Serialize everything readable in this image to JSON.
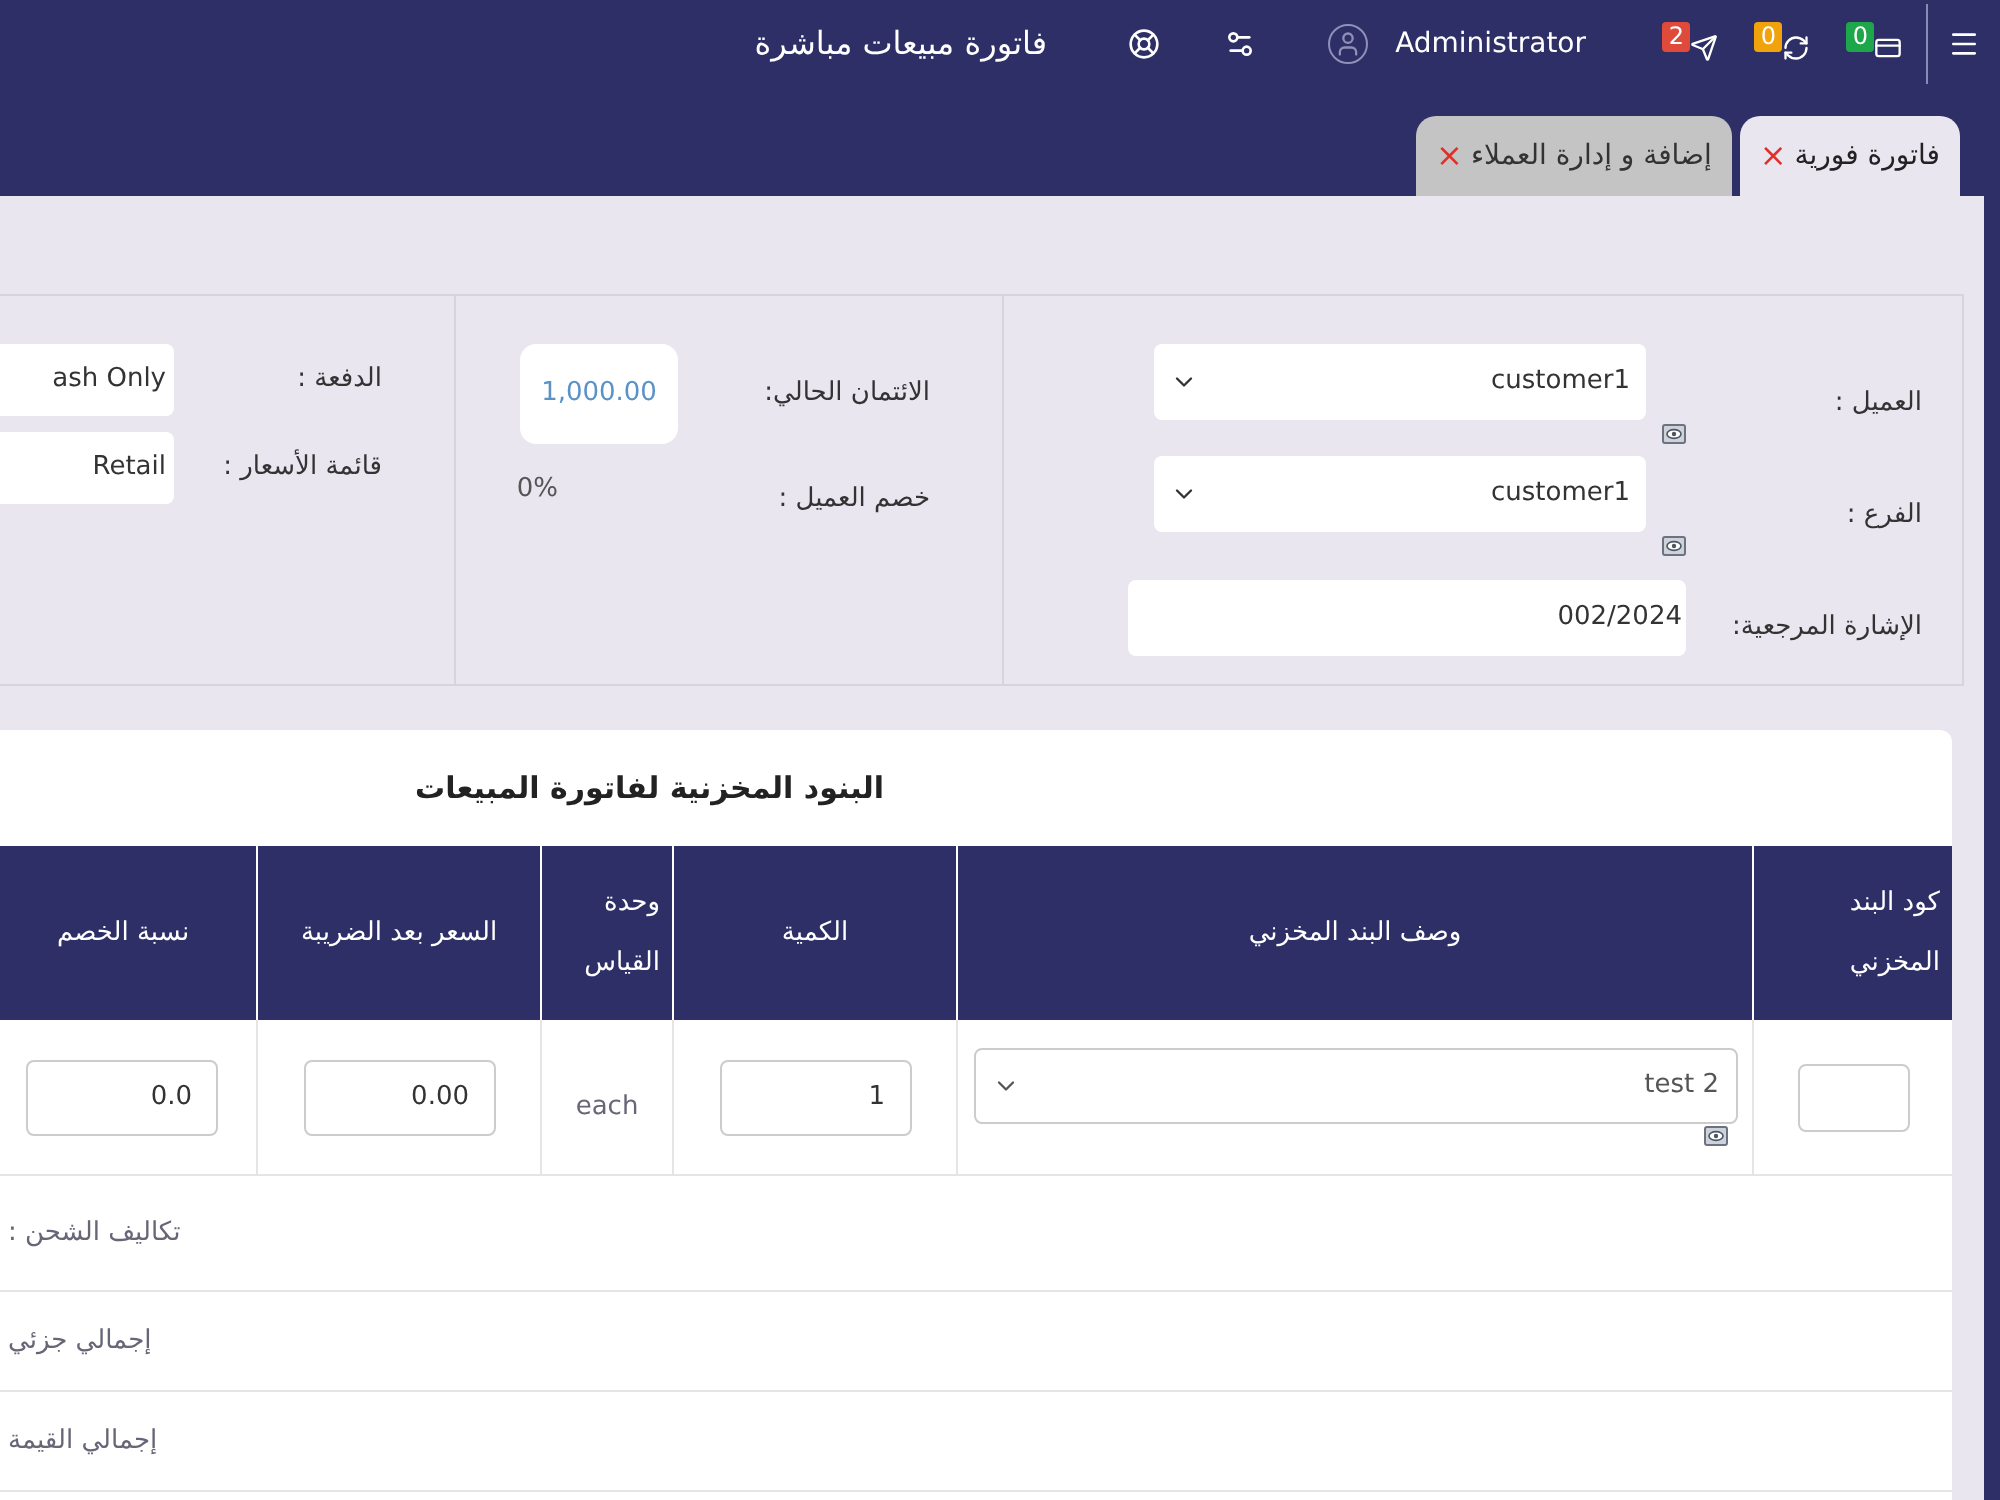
{
  "header": {
    "title": "فاتورة مبيعات مباشرة",
    "user": "Administrator",
    "notifications": [
      {
        "kind": "tasks",
        "count": "0",
        "color": "#1ea64a"
      },
      {
        "kind": "sync",
        "count": "0",
        "color": "#f0a30a"
      },
      {
        "kind": "send",
        "count": "2",
        "color": "#e04a3a"
      }
    ]
  },
  "tabs": [
    {
      "label": "فاتورة فورية",
      "close": "×",
      "selected": true
    },
    {
      "label": "إضافة و إدارة العملاء",
      "close": "×",
      "selected": false
    }
  ],
  "form": {
    "customer": [
      {
        "label": "العميل :",
        "kind": "select",
        "value": "customer1"
      },
      {
        "label": "الفرع :",
        "kind": "select",
        "value": "customer1"
      },
      {
        "label": "الإشارة المرجعية:",
        "kind": "input",
        "value": "002/2024"
      }
    ],
    "credit": [
      {
        "label": "الائتمان الحالي:",
        "kind": "box",
        "value": "1,000.00"
      },
      {
        "label": "خصم العميل :",
        "kind": "text",
        "value": "0%"
      }
    ],
    "payment": [
      {
        "label": "الدفعة :",
        "value": "ash Only"
      },
      {
        "label": "قائمة الأسعار :",
        "value": "Retail"
      }
    ]
  },
  "table": {
    "title": "البنود المخزنية لفاتورة المبيعات",
    "columns": [
      "كود البند المخزني",
      "وصف البند المخزني",
      "الكمية",
      "وحدة القياس",
      "السعر بعد الضريبة",
      "نسبة الخصم"
    ],
    "rows": [
      {
        "description": "test 2",
        "quantity": "1",
        "unit": "each",
        "price": "0.00",
        "discount": "0.0"
      }
    ],
    "totals": [
      "تكاليف الشحن :",
      "إجمالي جزئي",
      "إجمالي القيمة"
    ]
  }
}
